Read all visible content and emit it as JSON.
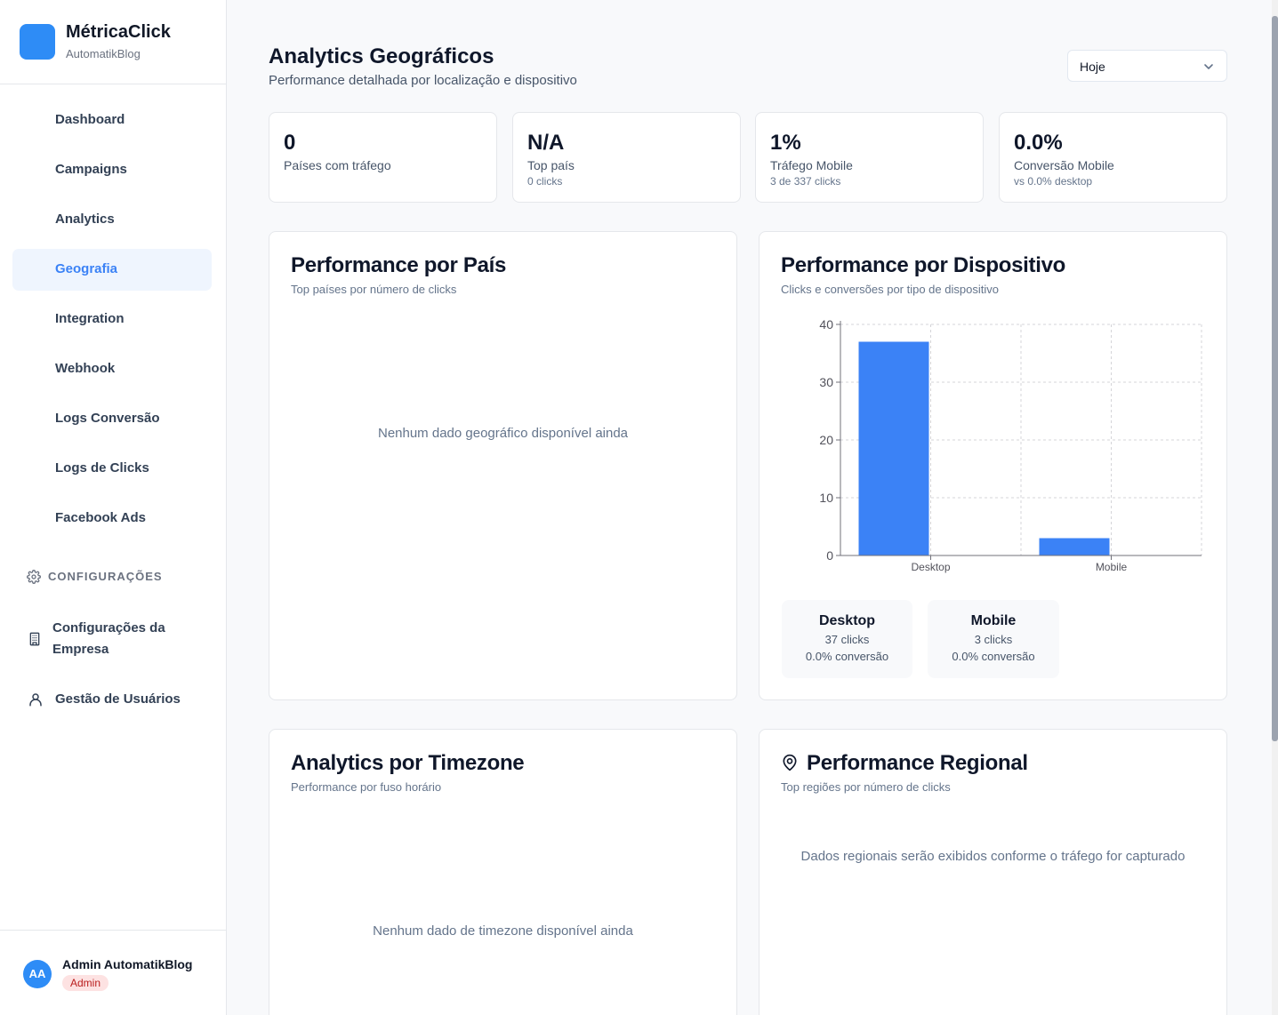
{
  "brand": {
    "name": "MétricaClick",
    "subtitle": "AutomatikBlog"
  },
  "sidebar": {
    "items": [
      {
        "label": "Dashboard"
      },
      {
        "label": "Campaigns"
      },
      {
        "label": "Analytics"
      },
      {
        "label": "Geografia",
        "active": true
      },
      {
        "label": "Integration"
      },
      {
        "label": "Webhook"
      },
      {
        "label": "Logs Conversão"
      },
      {
        "label": "Logs de Clicks"
      },
      {
        "label": "Facebook Ads"
      }
    ],
    "settings_header": "CONFIGURAÇÕES",
    "settings_items": [
      {
        "label": "Configurações da Empresa",
        "icon": "building-icon"
      },
      {
        "label": "Gestão de Usuários",
        "icon": "user-icon"
      }
    ],
    "user": {
      "initials": "AA",
      "name": "Admin AutomatikBlog",
      "role": "Admin"
    }
  },
  "header": {
    "title": "Analytics Geográficos",
    "subtitle": "Performance detalhada por localização e dispositivo",
    "period": "Hoje"
  },
  "stats": [
    {
      "value": "0",
      "label": "Países com tráfego",
      "sub": ""
    },
    {
      "value": "N/A",
      "label": "Top país",
      "sub": "0 clicks"
    },
    {
      "value": "1%",
      "label": "Tráfego Mobile",
      "sub": "3 de 337 clicks"
    },
    {
      "value": "0.0%",
      "label": "Conversão Mobile",
      "sub": "vs 0.0% desktop"
    }
  ],
  "country_card": {
    "title": "Performance por País",
    "subtitle": "Top países por número de clicks",
    "empty": "Nenhum dado geográfico disponível ainda"
  },
  "device_card": {
    "title": "Performance por Dispositivo",
    "subtitle": "Clicks e conversões por tipo de dispositivo",
    "devices": [
      {
        "name": "Desktop",
        "clicks": "37 clicks",
        "conversion": "0.0% conversão"
      },
      {
        "name": "Mobile",
        "clicks": "3 clicks",
        "conversion": "0.0% conversão"
      }
    ]
  },
  "timezone_card": {
    "title": "Analytics por Timezone",
    "subtitle": "Performance por fuso horário",
    "empty": "Nenhum dado de timezone disponível ainda"
  },
  "regional_card": {
    "title": "Performance Regional",
    "subtitle": "Top regiões por número de clicks",
    "empty": "Dados regionais serão exibidos conforme o tráfego for capturado"
  },
  "colors": {
    "accent": "#3b82f6",
    "bar": "#3b82f6",
    "badge_bg": "#fde2e2",
    "badge_text": "#b91c1c"
  },
  "chart_data": {
    "type": "bar",
    "categories": [
      "Desktop",
      "Mobile"
    ],
    "values": [
      37,
      3
    ],
    "title": "",
    "xlabel": "",
    "ylabel": "",
    "ylim": [
      0,
      40
    ],
    "yticks": [
      0,
      10,
      20,
      30,
      40
    ],
    "grid": true
  }
}
